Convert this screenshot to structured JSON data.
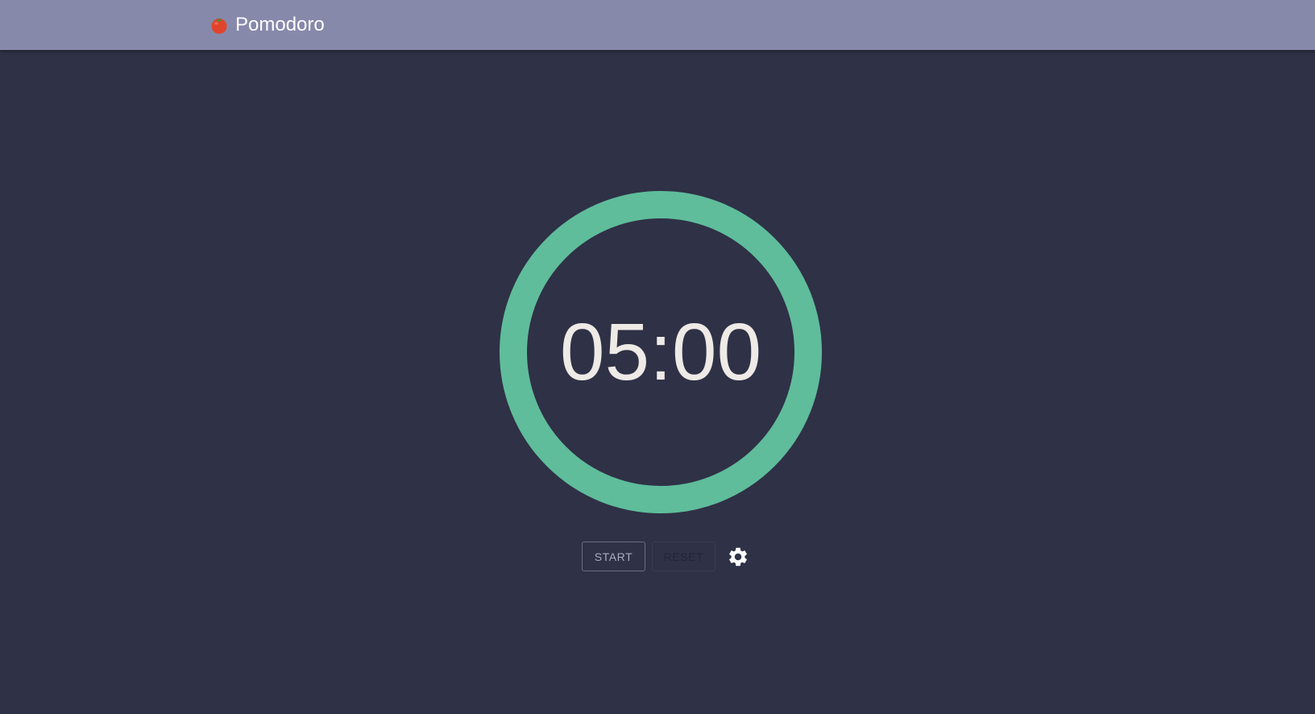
{
  "app_bar": {
    "title": "Pomodoro",
    "logo_icon": "tomato-icon"
  },
  "timer": {
    "display": "05:00",
    "progress_fraction": 1.0
  },
  "controls": {
    "start_label": "START",
    "reset_label": "RESET",
    "settings_icon": "gear-icon"
  },
  "colors": {
    "app_bar": "#8789ab",
    "background": "#2f3146",
    "ring": "#5fbd9b",
    "timer_text": "#eeeae6",
    "tomato": "#e0452c"
  }
}
